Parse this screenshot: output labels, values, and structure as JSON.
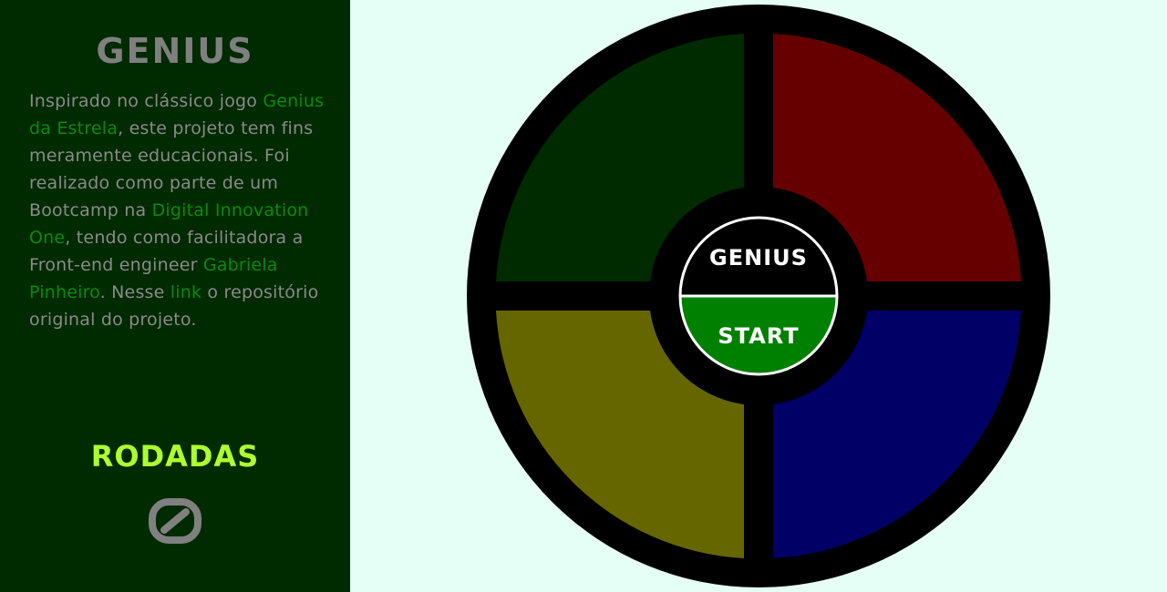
{
  "sidebar": {
    "title": "GENIUS",
    "description": {
      "p1": "Inspirado no clássico jogo ",
      "link1": "Genius da Estrela",
      "p2": ", este projeto tem fins meramente educacionais. Foi realizado como parte de um Bootcamp na ",
      "link2": "Digital Innovation One",
      "p3": ", tendo como facilitadora a Front-end engineer ",
      "link3": "Gabriela Pinheiro",
      "p4": ". Nesse ",
      "link4": "link",
      "p5": " o repositório original do projeto."
    },
    "rounds_title": "RODADAS",
    "rounds_count": 0
  },
  "game": {
    "center_label": "GENIUS",
    "start_label": "START",
    "pads": [
      {
        "id": "green",
        "color": "#002a00"
      },
      {
        "id": "red",
        "color": "#660000"
      },
      {
        "id": "yellow",
        "color": "#666600"
      },
      {
        "id": "blue",
        "color": "#000066"
      }
    ]
  },
  "colors": {
    "page_background": "#e6fff6",
    "sidebar_background": "#002a00",
    "link_color": "#0a8a0a",
    "rounds_title_color": "#adff2f",
    "muted_text": "#808080",
    "start_button": "#008000"
  }
}
